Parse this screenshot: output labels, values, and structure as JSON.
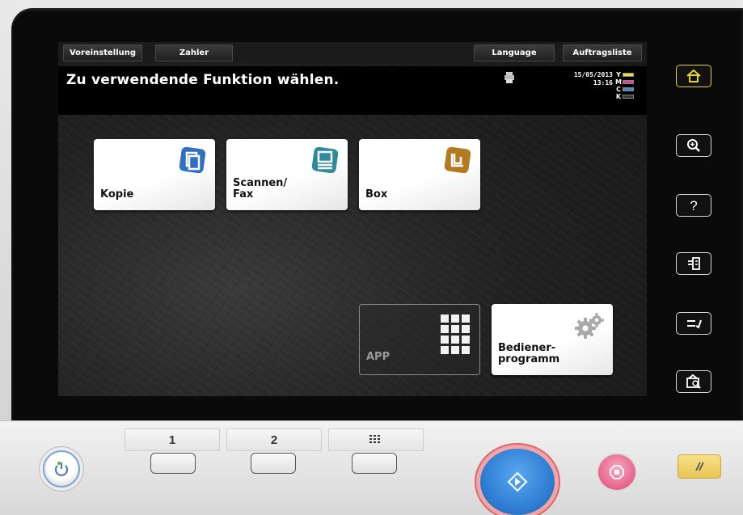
{
  "tabs": {
    "settings": "Voreinstellung",
    "counter": "Zahler",
    "language": "Language",
    "job_list": "Auftragsliste"
  },
  "header": {
    "prompt": "Zu verwendende Funktion wählen.",
    "date": "15/05/2013",
    "time": "13:16"
  },
  "toner": [
    {
      "letter": "Y",
      "color": "#f2dc3a"
    },
    {
      "letter": "M",
      "color": "#e0408e"
    },
    {
      "letter": "C",
      "color": "#3a8fd8"
    },
    {
      "letter": "K",
      "color": "#333333"
    }
  ],
  "tiles": {
    "copy": "Kopie",
    "scan_fax": "Scannen/\nFax",
    "box": "Box",
    "app": "APP",
    "utility": "Bediener-\nprogramm"
  },
  "keypad": {
    "key1": "1",
    "key2": "2"
  },
  "icons": {
    "home": "home-icon",
    "zoom": "zoom-in-icon",
    "help": "help-icon",
    "access": "access-icon",
    "accessibility": "accessibility-icon",
    "preview": "preview-icon",
    "power": "power-icon",
    "start": "start-icon",
    "stop": "stop-icon",
    "reset": "reset-icon",
    "numeric_keypad": "keypad-icon"
  },
  "colors": {
    "copy_icon": "#2f6fc4",
    "scan_icon": "#2f8a9a",
    "box_icon": "#b27b1f",
    "home_border": "#e2d43a",
    "start": "#2f7fd4",
    "stop": "#e7638b",
    "reset": "#e9c554"
  }
}
